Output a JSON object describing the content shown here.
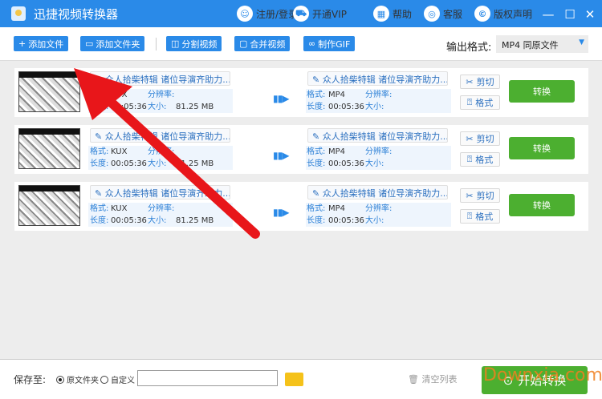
{
  "app": {
    "title": "迅捷视频转换器"
  },
  "titlebar": {
    "nav": [
      {
        "label": "注册/登录",
        "icon": "user-icon"
      },
      {
        "label": "开通VIP",
        "icon": "cart-icon"
      },
      {
        "label": "帮助",
        "icon": "grid-icon"
      },
      {
        "label": "客服",
        "icon": "headset-icon"
      },
      {
        "label": "版权声明",
        "icon": "copyright-icon"
      }
    ]
  },
  "toolbar": {
    "add_file": "添加文件",
    "add_folder": "添加文件夹",
    "split": "分割视频",
    "merge": "合并视频",
    "gif": "制作GIF",
    "format_label": "输出格式:",
    "format_value": "MP4  同原文件"
  },
  "labels": {
    "format": "格式:",
    "resolution": "分辨率:",
    "duration": "长度:",
    "size": "大小:",
    "cut": "剪切",
    "fmt": "格式",
    "convert": "转换"
  },
  "rows": [
    {
      "name": "众人拾柴特辑 诸位导演齐助力...",
      "format": "KUX",
      "duration": "00:05:36",
      "size": "81.25 MB",
      "out_name": "众人拾柴特辑 诸位导演齐助力...",
      "out_format": "MP4",
      "out_duration": "00:05:36"
    },
    {
      "name": "众人拾柴特辑 诸位导演齐助力...",
      "format": "KUX",
      "duration": "00:05:36",
      "size": "81.25 MB",
      "out_name": "众人拾柴特辑 诸位导演齐助力...",
      "out_format": "MP4",
      "out_duration": "00:05:36"
    },
    {
      "name": "众人拾柴特辑 诸位导演齐助力...",
      "format": "KUX",
      "duration": "00:05:36",
      "size": "81.25 MB",
      "out_name": "众人拾柴特辑 诸位导演齐助力...",
      "out_format": "MP4",
      "out_duration": "00:05:36"
    }
  ],
  "bottom": {
    "save_to": "保存至:",
    "opt_original": "原文件夹",
    "opt_custom": "自定义",
    "path_value": "",
    "clear": "清空列表",
    "start": "开始转换"
  },
  "watermark": "Downxia.com",
  "colors": {
    "primary": "#2a8ae8",
    "green": "#4caf30",
    "annotation": "#e8161a"
  }
}
